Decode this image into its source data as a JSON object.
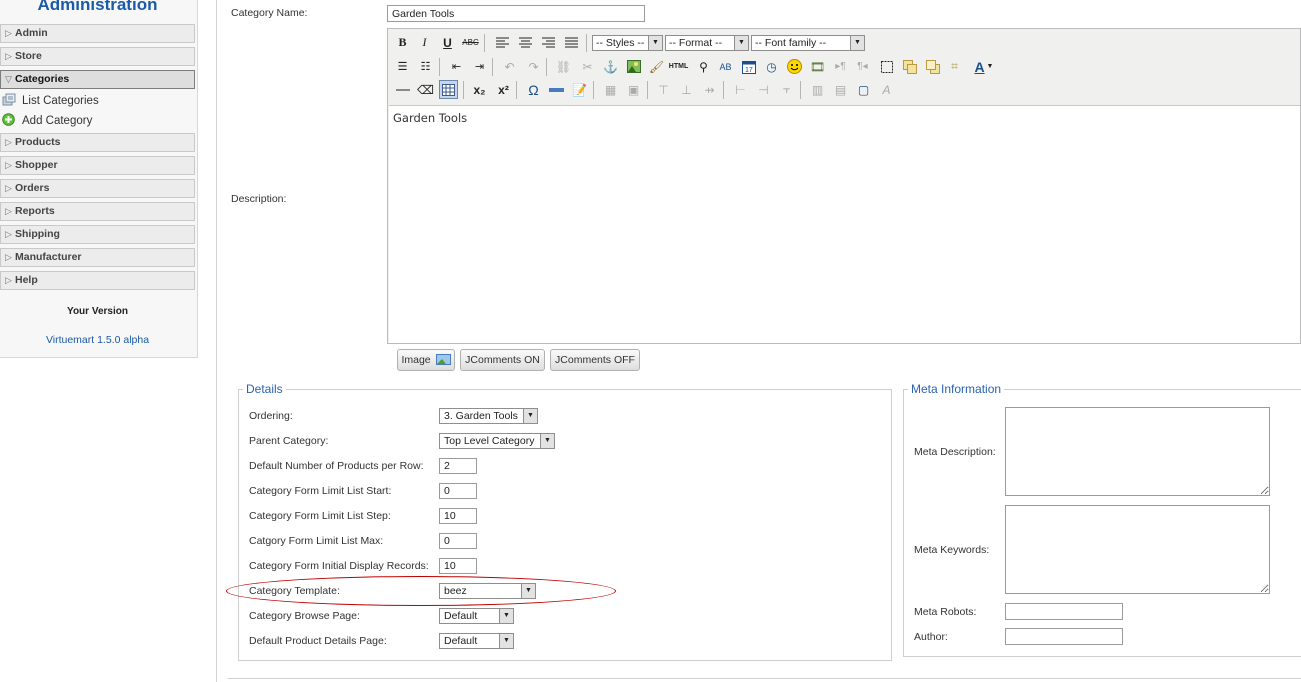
{
  "sidebar": {
    "title": "Administration",
    "items": [
      {
        "label": "Admin"
      },
      {
        "label": "Store"
      },
      {
        "label": "Categories"
      },
      {
        "label": "Products"
      },
      {
        "label": "Shopper"
      },
      {
        "label": "Orders"
      },
      {
        "label": "Reports"
      },
      {
        "label": "Shipping"
      },
      {
        "label": "Manufacturer"
      },
      {
        "label": "Help"
      }
    ],
    "sub_items": [
      {
        "label": "List Categories",
        "icon": "list-icon"
      },
      {
        "label": "Add Category",
        "icon": "add-icon"
      }
    ],
    "version_title": "Your Version",
    "version_link": "Virtuemart 1.5.0 alpha"
  },
  "form": {
    "category_name_label": "Category Name:",
    "category_name_value": "Garden Tools",
    "description_label": "Description:",
    "description_text": "Garden Tools"
  },
  "editor": {
    "styles_select": "-- Styles --",
    "format_select": "-- Format --",
    "font_select": "-- Font family --",
    "buttons": {
      "image": "Image",
      "jcomments_on": "JComments ON",
      "jcomments_off": "JComments OFF"
    }
  },
  "details": {
    "legend": "Details",
    "ordering_label": "Ordering:",
    "ordering_value": "3. Garden Tools",
    "parent_label": "Parent Category:",
    "parent_value": "Top Level Category",
    "per_row_label": "Default Number of Products per Row:",
    "per_row_value": "2",
    "limit_start_label": "Category Form Limit List Start:",
    "limit_start_value": "0",
    "limit_step_label": "Category Form Limit List Step:",
    "limit_step_value": "10",
    "limit_max_label": "Catgory Form Limit List Max:",
    "limit_max_value": "0",
    "initial_label": "Category Form Initial Display Records:",
    "initial_value": "10",
    "template_label": "Category Template:",
    "template_value": "beez",
    "browse_label": "Category Browse Page:",
    "browse_value": "Default",
    "product_details_label": "Default Product Details Page:",
    "product_details_value": "Default"
  },
  "meta": {
    "legend": "Meta Information",
    "description_label": "Meta Description:",
    "keywords_label": "Meta Keywords:",
    "robots_label": "Meta Robots:",
    "author_label": "Author:"
  },
  "colors": {
    "accent": "#1a5aa6",
    "highlight": "#c00000"
  }
}
